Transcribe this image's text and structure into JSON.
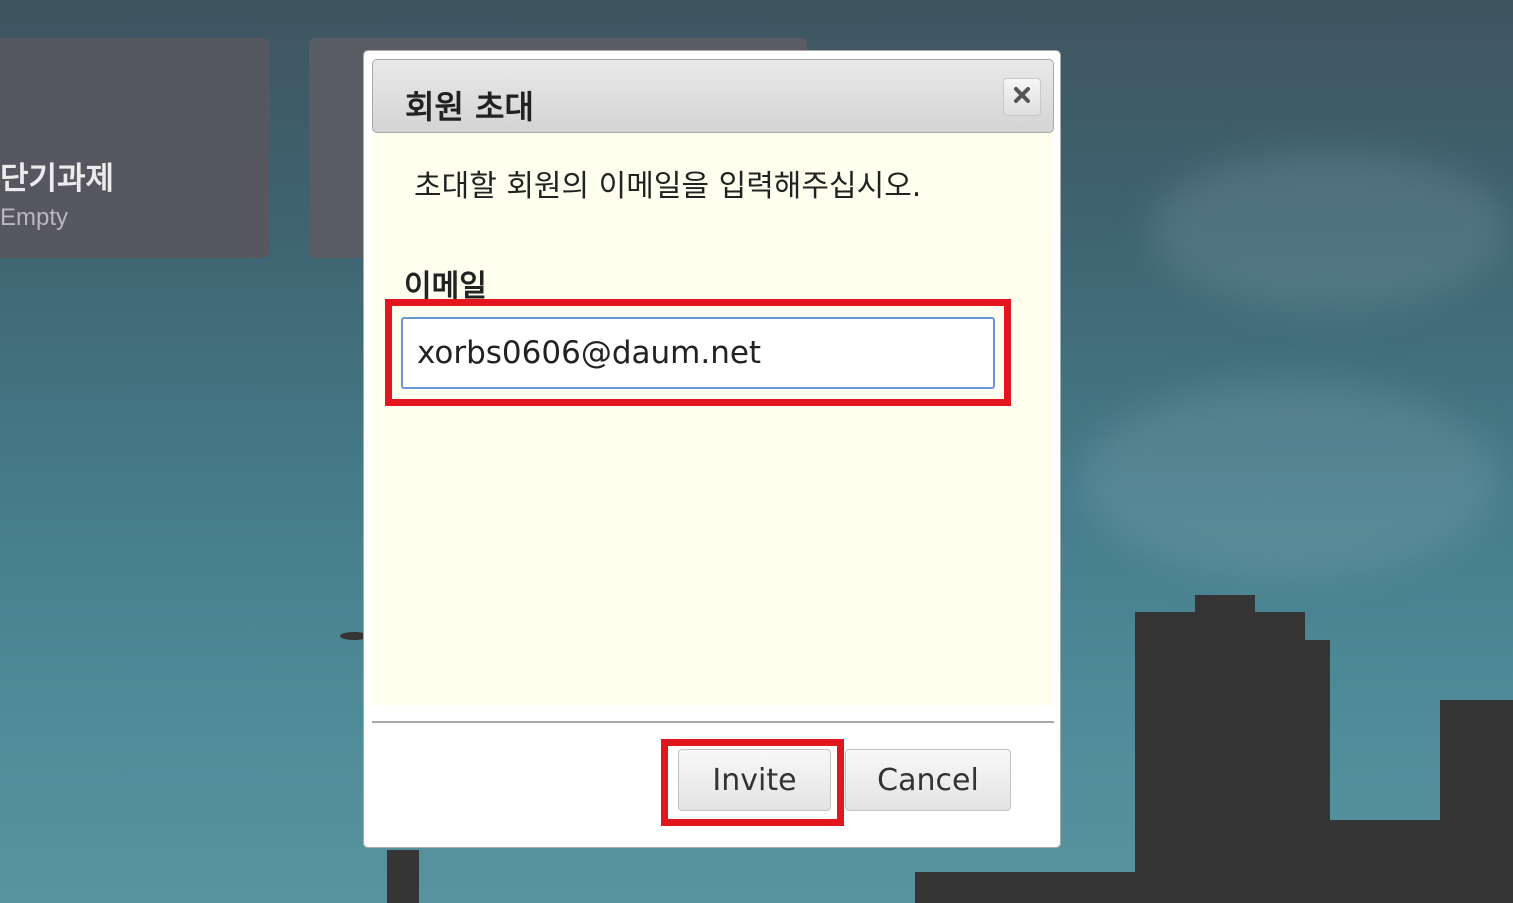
{
  "background": {
    "board_cards": [
      {
        "title": "단기과제",
        "subtitle": "Empty"
      },
      {
        "title": "",
        "subtitle": ""
      }
    ]
  },
  "dialog": {
    "title": "회원 초대",
    "close_icon": "close-icon",
    "instruction": "초대할 회원의 이메일을 입력해주십시오.",
    "email_label": "이메일",
    "email_value": "xorbs0606@daum.net",
    "invite_label": "Invite",
    "cancel_label": "Cancel"
  },
  "colors": {
    "highlight": "#e3151e",
    "content_bg": "#fffff0",
    "input_focus_border": "#6b97d8"
  }
}
